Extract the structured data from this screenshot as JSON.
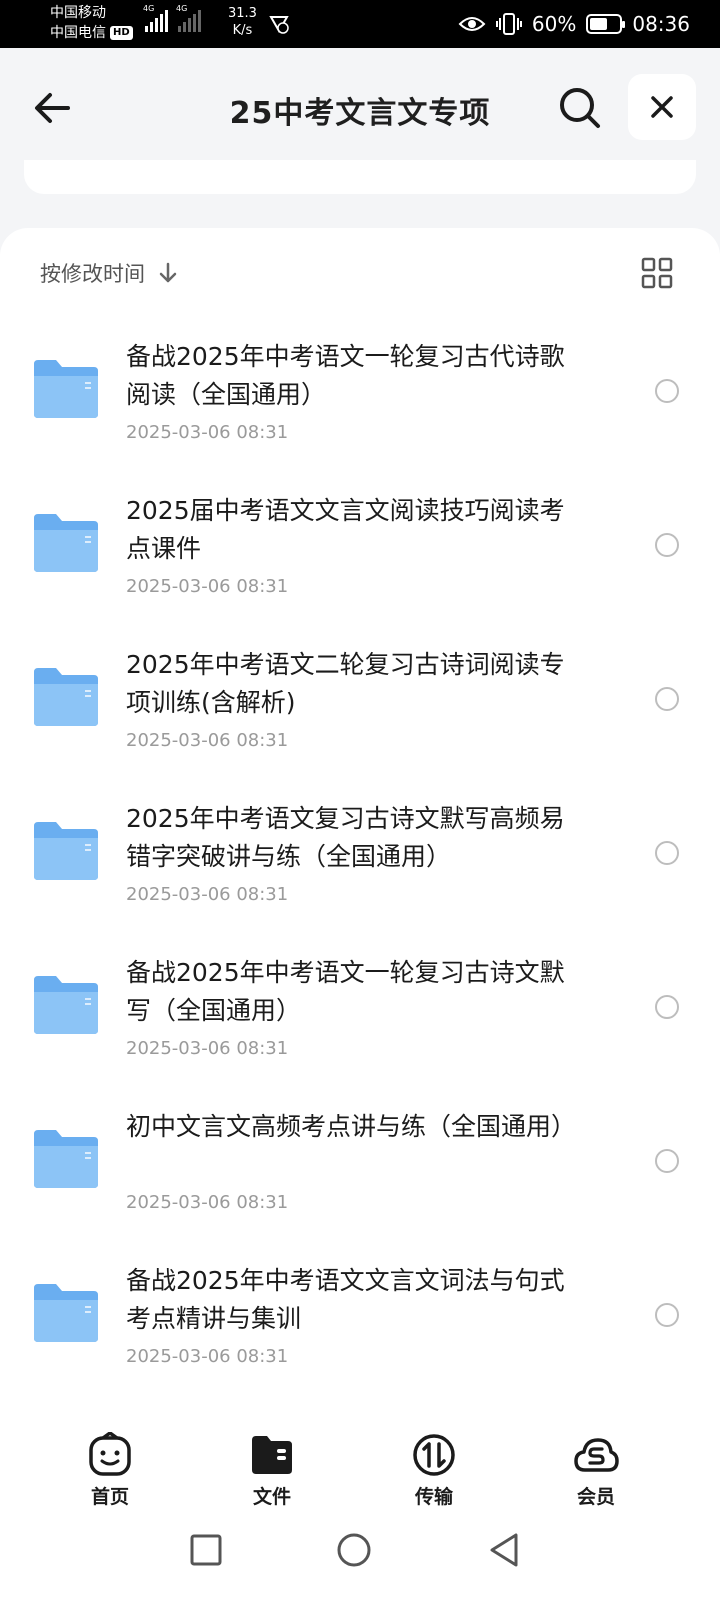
{
  "status_bar": {
    "carrier_1": "中国移动",
    "carrier_2": "中国电信",
    "hd_badge": "HD",
    "network_1": "4G",
    "network_2": "4G",
    "speed_value": "31.3",
    "speed_unit": "K/s",
    "battery_text": "60%",
    "battery_level": 0.6,
    "time": "08:36"
  },
  "header": {
    "title": "25中考文言文专项"
  },
  "sort": {
    "label": "按修改时间"
  },
  "files": [
    {
      "name": "备战2025年中考语文一轮复习古代诗歌阅读（全国通用）",
      "date": "2025-03-06 08:31"
    },
    {
      "name": "2025届中考语文文言文阅读技巧阅读考点课件",
      "date": "2025-03-06 08:31"
    },
    {
      "name": "2025年中考语文二轮复习古诗词阅读专项训练(含解析)",
      "date": "2025-03-06 08:31"
    },
    {
      "name": "2025年中考语文复习古诗文默写高频易错字突破讲与练（全国通用）",
      "date": "2025-03-06 08:31"
    },
    {
      "name": "备战2025年中考语文一轮复习古诗文默写（全国通用）",
      "date": "2025-03-06 08:31"
    },
    {
      "name": "初中文言文高频考点讲与练（全国通用）",
      "date": "2025-03-06 08:31"
    },
    {
      "name": "备战2025年中考语文文言文词法与句式考点精讲与集训",
      "date": "2025-03-06 08:31"
    }
  ],
  "bottom_nav": {
    "home": "首页",
    "files": "文件",
    "transfer": "传输",
    "member": "会员"
  },
  "colors": {
    "folder": "#6aaef0",
    "folder_light": "#8cc4f6",
    "background": "#f4f5f7"
  }
}
